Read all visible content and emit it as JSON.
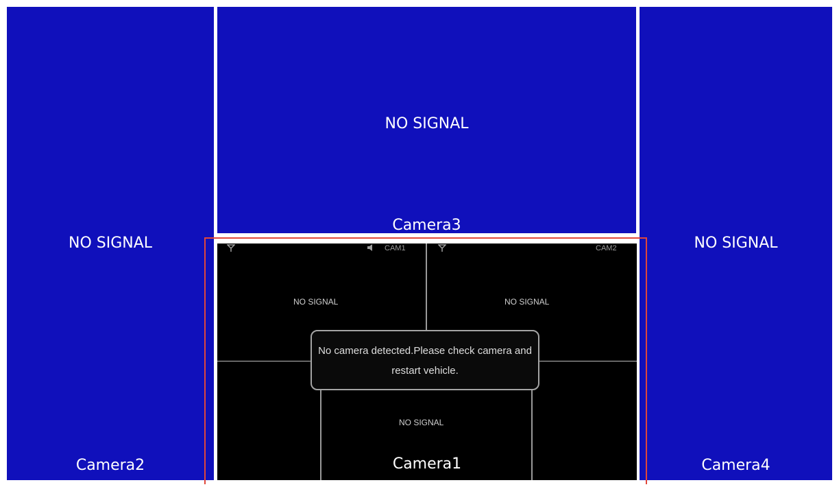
{
  "colors": {
    "panel_blue": "#1010bb",
    "feed_black": "#000000",
    "highlight_red": "#e0473a",
    "divider_white": "#ffffff"
  },
  "camera2": {
    "status": "NO SIGNAL",
    "label": "Camera2"
  },
  "camera3": {
    "status": "NO SIGNAL",
    "label": "Camera3"
  },
  "camera4": {
    "status": "NO SIGNAL",
    "label": "Camera4"
  },
  "camera1": {
    "label": "Camera1",
    "inner_screen": {
      "tl_title": "CAM1",
      "tr_title": "CAM2",
      "tl_status": "NO SIGNAL",
      "tr_status": "NO SIGNAL",
      "bottom_status": "NO SIGNAL",
      "icons": [
        "antenna-icon",
        "speaker-icon",
        "antenna-icon"
      ],
      "dialog_text": "No camera detected.Please check camera and restart vehicle."
    }
  }
}
